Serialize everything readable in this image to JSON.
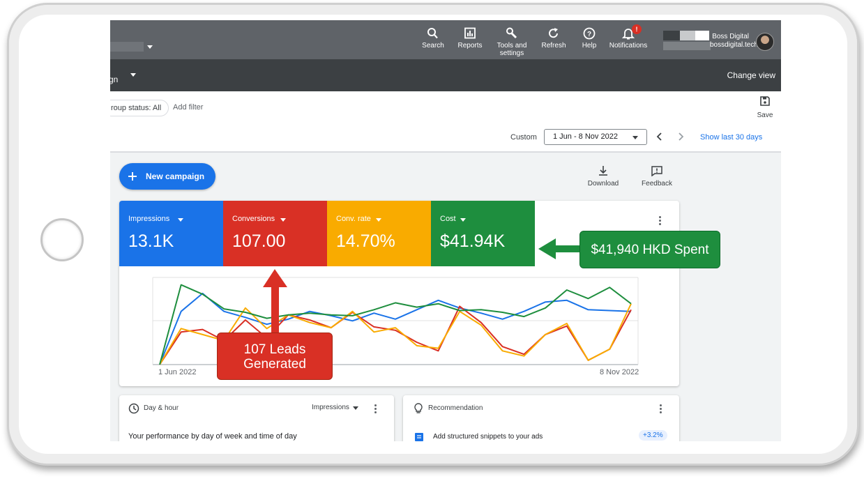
{
  "topbar": {
    "items": [
      {
        "label": "Search",
        "icon": "search-icon"
      },
      {
        "label": "Reports",
        "icon": "bar-chart-icon"
      },
      {
        "label": "Tools and",
        "label2": "settings",
        "icon": "wrench-icon"
      },
      {
        "label": "Refresh",
        "icon": "refresh-icon"
      },
      {
        "label": "Help",
        "icon": "help-icon"
      },
      {
        "label": "Notifications",
        "icon": "bell-icon",
        "badge": "!"
      }
    ],
    "account_name": "Boss Digital",
    "account_domain": "bossdigital.tech"
  },
  "navbar": {
    "title_fragment": "gn",
    "change_view": "Change view"
  },
  "filterbar": {
    "status_chip": "roup status: All",
    "add_filter": "Add filter",
    "save": "Save"
  },
  "datebar": {
    "custom_label": "Custom",
    "date_range": "1 Jun - 8 Nov 2022",
    "show_last": "Show last 30 days"
  },
  "actions": {
    "new_campaign": "New campaign",
    "download": "Download",
    "feedback": "Feedback"
  },
  "metrics": [
    {
      "label": "Impressions",
      "value": "13.1K",
      "color": "#1a73e8"
    },
    {
      "label": "Conversions",
      "value": "107.00",
      "color": "#d93025"
    },
    {
      "label": "Conv. rate",
      "value": "14.70%",
      "color": "#f9ab00"
    },
    {
      "label": "Cost",
      "value": "$41.94K",
      "color": "#1e8e3e"
    }
  ],
  "chart_data": {
    "type": "line",
    "x_start_label": "1 Jun 2022",
    "x_end_label": "8 Nov 2022",
    "y_axis_shown": false,
    "grid": "horizontal",
    "series": [
      {
        "name": "Impressions",
        "color": "#1a73e8",
        "values": [
          0.0,
          0.62,
          0.83,
          0.62,
          0.55,
          0.47,
          0.53,
          0.62,
          0.57,
          0.51,
          0.6,
          0.53,
          0.64,
          0.75,
          0.66,
          0.6,
          0.53,
          0.62,
          0.73,
          0.75,
          0.64,
          0.63,
          0.62
        ]
      },
      {
        "name": "Conversions",
        "color": "#d93025",
        "values": [
          0.0,
          0.38,
          0.41,
          0.28,
          0.52,
          0.31,
          0.58,
          0.52,
          0.43,
          0.61,
          0.44,
          0.4,
          0.26,
          0.16,
          0.68,
          0.49,
          0.21,
          0.12,
          0.35,
          0.45,
          0.05,
          0.18,
          0.64
        ]
      },
      {
        "name": "Conv. rate",
        "color": "#f9ab00",
        "values": [
          0.0,
          0.42,
          0.35,
          0.28,
          0.66,
          0.42,
          0.58,
          0.49,
          0.43,
          0.62,
          0.38,
          0.43,
          0.22,
          0.19,
          0.62,
          0.46,
          0.16,
          0.1,
          0.35,
          0.48,
          0.05,
          0.18,
          0.71
        ]
      },
      {
        "name": "Cost",
        "color": "#1e8e3e",
        "values": [
          0.0,
          0.93,
          0.82,
          0.65,
          0.61,
          0.54,
          0.58,
          0.6,
          0.58,
          0.57,
          0.64,
          0.72,
          0.67,
          0.71,
          0.63,
          0.64,
          0.61,
          0.56,
          0.66,
          0.87,
          0.77,
          0.9,
          0.71
        ]
      }
    ]
  },
  "bottom": {
    "day_hour_title": "Day & hour",
    "day_hour_metric": "Impressions",
    "day_hour_subtitle": "Your performance by day of week and time of day",
    "rec_title": "Recommendation",
    "rec_item": "Add structured snippets to your ads",
    "rec_badge": "+3.2%"
  },
  "annotations": {
    "cost_callout": "$41,940 HKD Spent",
    "leads_line1": "107 Leads",
    "leads_line2": "Generated",
    "green": "#1e8e3e",
    "red": "#d93025"
  }
}
